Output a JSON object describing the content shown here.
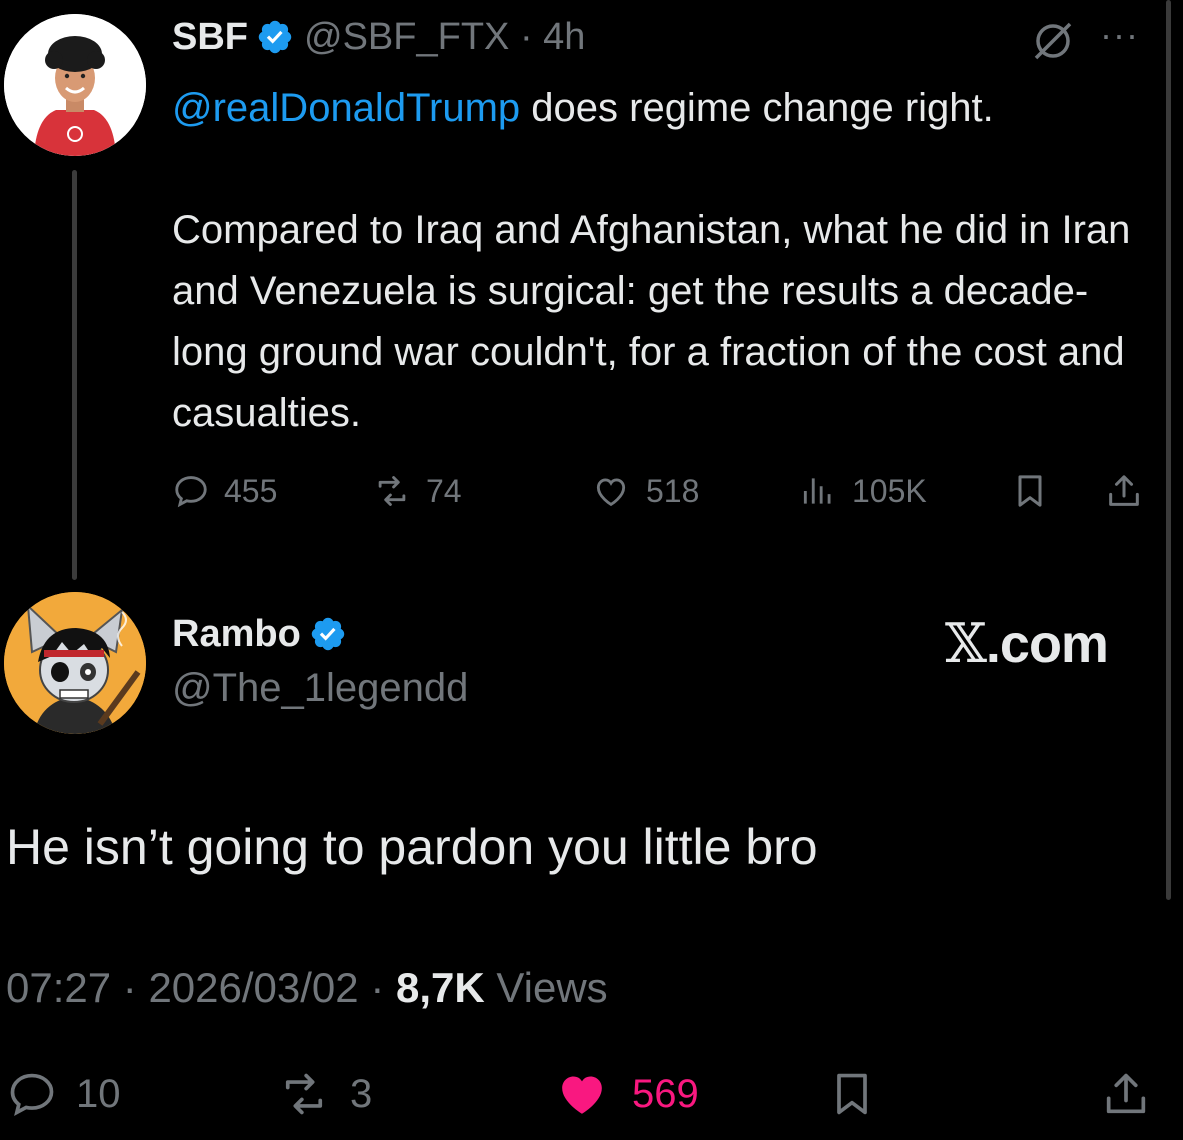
{
  "parent_tweet": {
    "name": "SBF",
    "handle": "@SBF_FTX",
    "time": "4h",
    "mention": "@realDonaldTrump",
    "line1_rest": " does regime change right.",
    "paragraph2": "Compared to Iraq and Afghanistan, what he did in Iran and Venezuela is surgical: get the results a decade-long ground war couldn't, for a fraction of the cost and casualties.",
    "replies": "455",
    "reposts": "74",
    "likes": "518",
    "views": "105K"
  },
  "reply_tweet": {
    "name": "Rambo",
    "handle": "@The_1legendd",
    "source_label": ".com",
    "text": "He isn’t going to pardon you little bro",
    "time": "07:27",
    "date": "2026/03/02",
    "views_count": "8,7K",
    "views_label": "Views",
    "replies": "10",
    "reposts": "3",
    "likes": "569"
  },
  "colors": {
    "background": "#000000",
    "text": "#e7e9ea",
    "muted": "#71767b",
    "link": "#1d9bf0",
    "verified": "#1d9bf0",
    "like_active": "#f91880"
  },
  "icons": [
    "reply-icon",
    "repost-icon",
    "like-icon",
    "views-icon",
    "bookmark-icon",
    "share-icon",
    "grok-icon",
    "more-icon",
    "verified-badge-icon"
  ]
}
